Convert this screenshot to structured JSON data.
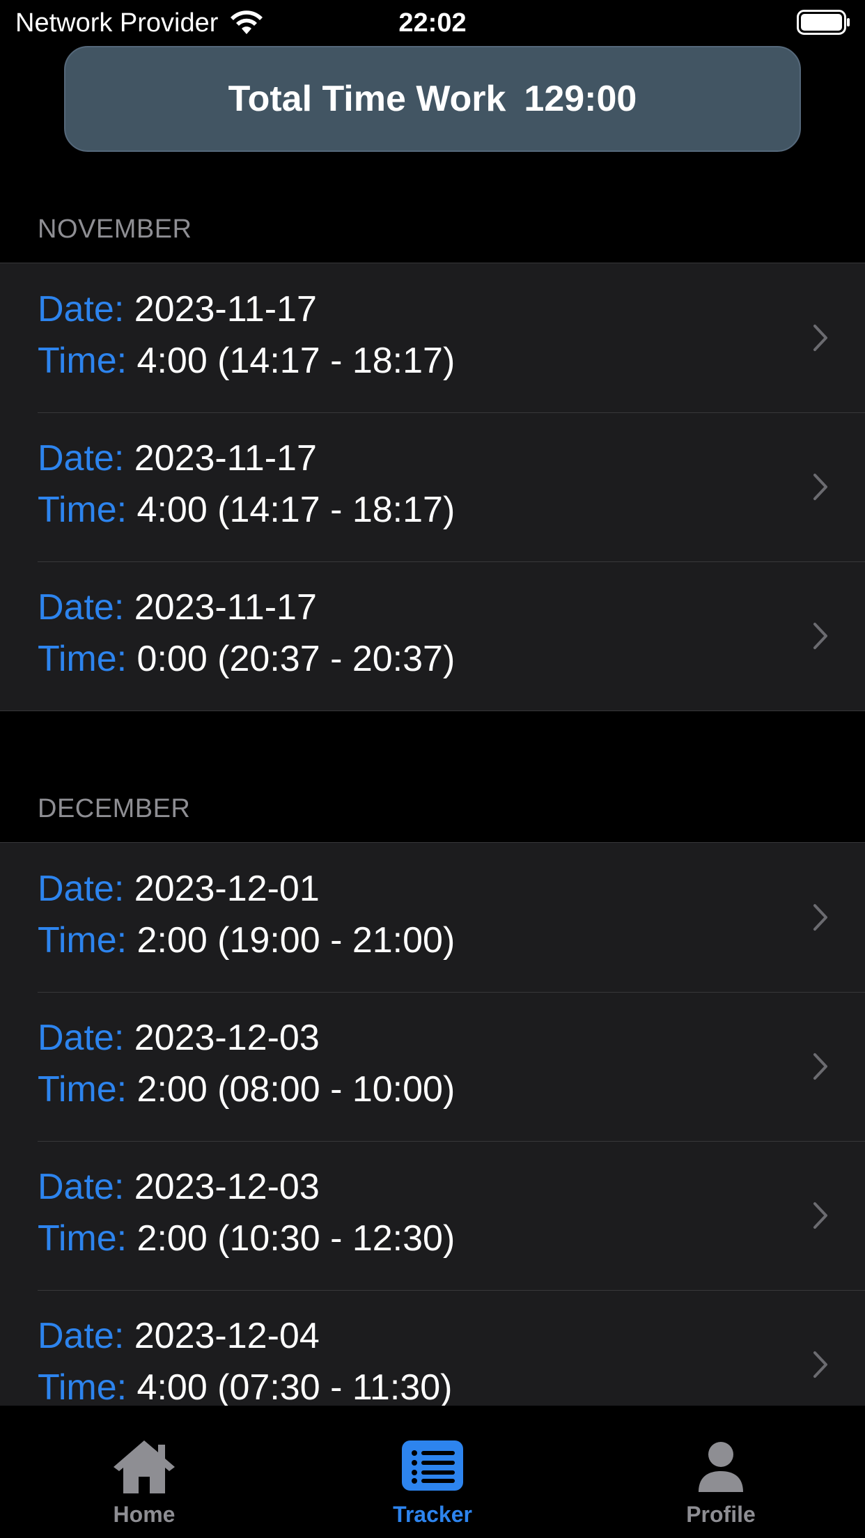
{
  "status_bar": {
    "carrier": "Network Provider",
    "time": "22:02"
  },
  "banner": {
    "label": "Total Time Work",
    "value": "129:00"
  },
  "labels": {
    "date": "Date:",
    "time": "Time:"
  },
  "sections": [
    {
      "header": "NOVEMBER",
      "entries": [
        {
          "date": "2023-11-17",
          "time": "4:00 (14:17 - 18:17)"
        },
        {
          "date": "2023-11-17",
          "time": "4:00 (14:17 - 18:17)"
        },
        {
          "date": "2023-11-17",
          "time": "0:00 (20:37 - 20:37)"
        }
      ]
    },
    {
      "header": "DECEMBER",
      "entries": [
        {
          "date": "2023-12-01",
          "time": "2:00 (19:00 - 21:00)"
        },
        {
          "date": "2023-12-03",
          "time": "2:00 (08:00 - 10:00)"
        },
        {
          "date": "2023-12-03",
          "time": "2:00 (10:30 - 12:30)"
        },
        {
          "date": "2023-12-04",
          "time": "4:00 (07:30 - 11:30)"
        }
      ]
    }
  ],
  "tabs": [
    {
      "label": "Home",
      "icon": "home-icon"
    },
    {
      "label": "Tracker",
      "icon": "list-icon",
      "active": true
    },
    {
      "label": "Profile",
      "icon": "person-icon"
    }
  ],
  "colors": {
    "accent": "#2d84ee",
    "banner": "#425563",
    "cell": "#1c1c1e",
    "inactive": "#8e8e93"
  }
}
